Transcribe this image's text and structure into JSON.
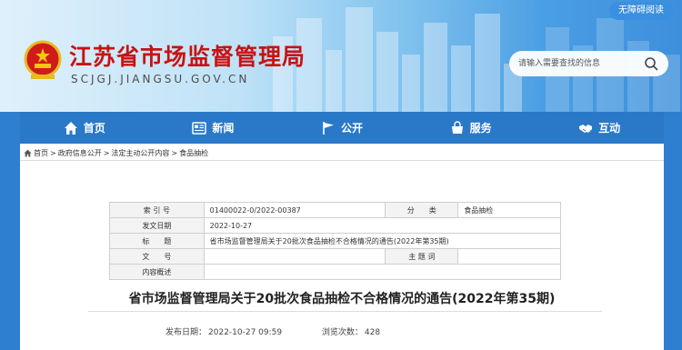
{
  "header": {
    "accessibility_label": "无障碍阅读",
    "site_title": "江苏省市场监督管理局",
    "site_domain": "SCJGJ.JIANGSU.GOV.CN",
    "search": {
      "placeholder": "请输入需要查找的信息"
    }
  },
  "nav": {
    "items": [
      {
        "label": "首页",
        "icon": "home-icon"
      },
      {
        "label": "新闻",
        "icon": "news-icon"
      },
      {
        "label": "公开",
        "icon": "flag-icon"
      },
      {
        "label": "服务",
        "icon": "service-icon"
      },
      {
        "label": "互动",
        "icon": "handshake-icon"
      }
    ]
  },
  "breadcrumb": {
    "items": [
      "首页",
      "政府信息公开",
      "法定主动公开内容",
      "食品抽检"
    ],
    "separator": ">"
  },
  "meta_table": {
    "index_label": "索 引 号",
    "index_value": "01400022-0/2022-00387",
    "category_label": "分　　类",
    "category_value": "食品抽检",
    "date_label": "发文日期",
    "date_value": "2022-10-27",
    "title_label": "标　　题",
    "title_value": "省市场监督管理局关于20批次食品抽检不合格情况的通告(2022年第35期)",
    "docno_label": "文　　号",
    "docno_value": "",
    "subject_label": "主 题 词",
    "subject_value": "",
    "summary_label": "内容概述",
    "summary_value": ""
  },
  "article": {
    "title": "省市场监督管理局关于20批次食品抽检不合格情况的通告(2022年第35期)",
    "publish_label": "发布日期：",
    "publish_time": "2022-10-27 09:59",
    "views_label": "浏览次数：",
    "views": "428"
  },
  "colors": {
    "nav_bg": "#2a78c8",
    "title_red": "#c81212",
    "page_bg": "#2f7fd0"
  }
}
